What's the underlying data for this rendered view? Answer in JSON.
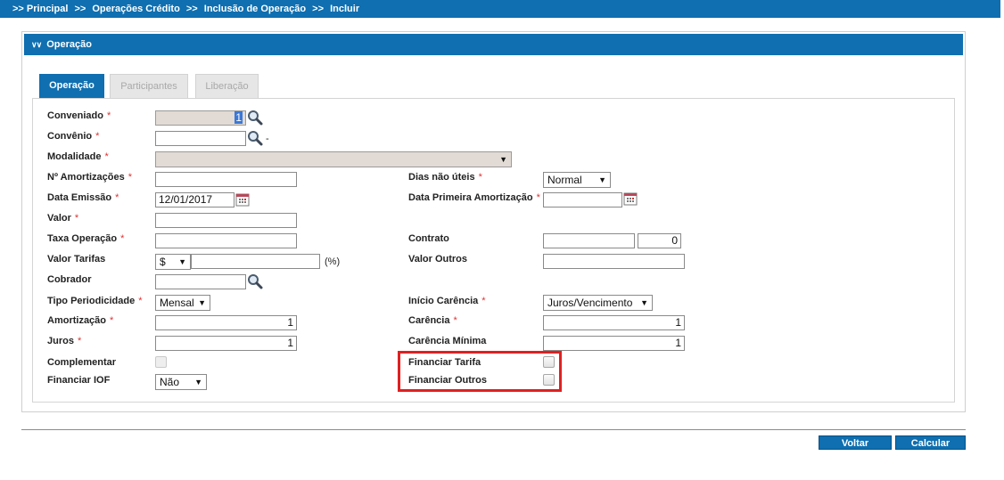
{
  "breadcrumb": {
    "items": [
      "Principal",
      "Operações Crédito",
      "Inclusão de Operação",
      "Incluir"
    ],
    "prefix": ">>"
  },
  "panel": {
    "title": "Operação"
  },
  "tabs": [
    {
      "label": "Operação",
      "active": true
    },
    {
      "label": "Participantes",
      "active": false
    },
    {
      "label": "Liberação",
      "active": false
    }
  ],
  "required_mark": "*",
  "form": {
    "conveniado": {
      "label": "Conveniado",
      "value": "1"
    },
    "convenio": {
      "label": "Convênio",
      "value": "",
      "suffix": "-"
    },
    "modalidade": {
      "label": "Modalidade",
      "value": ""
    },
    "n_amortizacoes": {
      "label": "Nº Amortizações",
      "value": ""
    },
    "dias_nao_uteis": {
      "label": "Dias não úteis",
      "value": "Normal"
    },
    "data_emissao": {
      "label": "Data Emissão",
      "value": "12/01/2017"
    },
    "data_primeira_amortizacao": {
      "label": "Data Primeira Amortização",
      "value": ""
    },
    "valor": {
      "label": "Valor",
      "value": ""
    },
    "taxa_operacao": {
      "label": "Taxa Operação",
      "value": ""
    },
    "contrato": {
      "label": "Contrato",
      "value": "",
      "value2": "0"
    },
    "valor_tarifas": {
      "label": "Valor Tarifas",
      "currency": "$",
      "value": "",
      "unit": "(%)"
    },
    "valor_outros": {
      "label": "Valor Outros",
      "value": ""
    },
    "cobrador": {
      "label": "Cobrador",
      "value": ""
    },
    "tipo_periodicidade": {
      "label": "Tipo Periodicidade",
      "value": "Mensal"
    },
    "inicio_carencia": {
      "label": "Início Carência",
      "value": "Juros/Vencimento"
    },
    "amortizacao": {
      "label": "Amortização",
      "value": "1"
    },
    "carencia": {
      "label": "Carência",
      "value": "1"
    },
    "juros": {
      "label": "Juros",
      "value": "1"
    },
    "carencia_minima": {
      "label": "Carência Mínima",
      "value": "1"
    },
    "complementar": {
      "label": "Complementar",
      "checked": false
    },
    "financiar_tarifa": {
      "label": "Financiar Tarifa",
      "checked": false
    },
    "financiar_iof": {
      "label": "Financiar IOF",
      "value": "Não"
    },
    "financiar_outros": {
      "label": "Financiar Outros",
      "checked": false
    }
  },
  "buttons": {
    "voltar": "Voltar",
    "calcular": "Calcular"
  },
  "colors": {
    "primary": "#0f6fb0",
    "required": "#d33333",
    "highlight": "#e02020"
  }
}
